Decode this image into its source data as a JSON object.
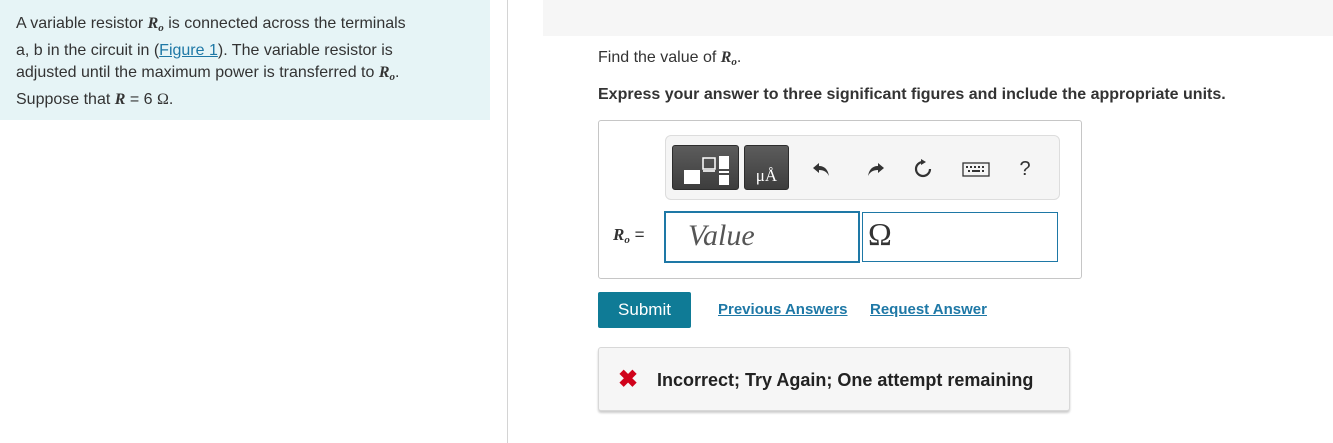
{
  "problem": {
    "p1": "A variable resistor ",
    "var_main": "R",
    "var_sub": "o",
    "p2": " is connected across the terminals",
    "p3": "a, b in the circuit in (",
    "figure_link": "Figure 1",
    "p4": "). The variable resistor is",
    "p5": "adjusted until the maximum power is transferred to ",
    "p6": ".",
    "p7": "Suppose that ",
    "r_var": "R",
    "p8": " = 6 ",
    "omega": "Ω",
    "p9": "."
  },
  "question": {
    "find_prefix": "Find the value of ",
    "find_var": "R",
    "find_sub": "o",
    "find_suffix": ".",
    "instruction": "Express your answer to three significant figures and include the appropriate units."
  },
  "toolbar": {
    "units_glyph": "μÅ",
    "help": "?"
  },
  "answer": {
    "label_var": "R",
    "label_sub": "o",
    "label_eq": " =",
    "value_placeholder": "Value",
    "unit": "Ω"
  },
  "actions": {
    "submit": "Submit",
    "previous_answers": "Previous Answers",
    "request_answer": "Request Answer"
  },
  "feedback": {
    "icon": "✖",
    "message": "Incorrect; Try Again; One attempt remaining"
  }
}
